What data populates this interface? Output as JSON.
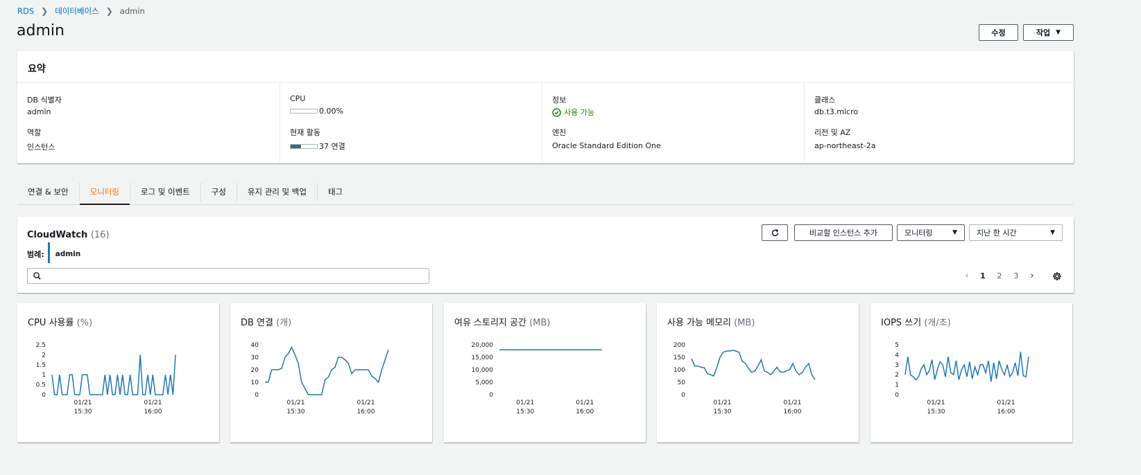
{
  "breadcrumb": {
    "root": "RDS",
    "middle": "데이터베이스",
    "current": "admin"
  },
  "page_title": "admin",
  "actions": {
    "modify": "수정",
    "actions_menu": "작업"
  },
  "summary": {
    "heading": "요약",
    "db_id_label": "DB 식별자",
    "db_id": "admin",
    "role_label": "역할",
    "role": "인스턴스",
    "cpu_label": "CPU",
    "cpu_value": "0.00%",
    "cpu_fraction": 0.0,
    "activity_label": "현재 활동",
    "activity_value": "37 연결",
    "activity_fraction": 0.4,
    "info_label": "정보",
    "info_value": "사용 가능",
    "engine_label": "엔진",
    "engine": "Oracle Standard Edition One",
    "class_label": "클래스",
    "class": "db.t3.micro",
    "region_label": "리전 및 AZ",
    "region": "ap-northeast-2a"
  },
  "tabs": [
    {
      "label": "연결 & 보안"
    },
    {
      "label": "모니터링"
    },
    {
      "label": "로그 및 이벤트"
    },
    {
      "label": "구성"
    },
    {
      "label": "유지 관리 및 백업"
    },
    {
      "label": "태그"
    }
  ],
  "cloudwatch": {
    "title": "CloudWatch",
    "count": "(16)",
    "legend_label": "범례:",
    "legend_item": "admin",
    "search_value": "",
    "compare_button": "비교할 인스턴스 추가",
    "monitoring_select": "모니터링",
    "time_select": "지난 한 시간",
    "pages": [
      "1",
      "2",
      "3"
    ],
    "current_page": "1"
  },
  "colors": {
    "line": "#1f77b4",
    "link": "#0073bb",
    "active_tab": "#ec7211",
    "available": "#1d8102"
  },
  "chart_data": [
    {
      "type": "line",
      "title": "CPU 사용률",
      "unit": "(%)",
      "yticks": [
        "2.5",
        "2",
        "1.5",
        "1",
        "0.5",
        "0"
      ],
      "ylim": [
        0,
        2.5
      ],
      "xticks": [
        [
          "01/21",
          "15:30"
        ],
        [
          "01/21",
          "16:00"
        ]
      ],
      "series": [
        {
          "values": [
            1,
            0,
            0,
            1,
            0,
            0,
            0,
            1,
            1,
            0,
            0,
            0,
            1,
            1,
            1,
            0,
            0,
            0,
            0,
            0,
            0,
            1,
            0,
            1,
            0,
            0,
            1,
            0,
            1,
            0,
            0,
            1,
            0,
            0,
            0,
            2,
            0,
            0,
            1,
            0,
            1,
            0,
            0,
            0,
            0,
            1,
            0,
            1,
            0,
            2
          ]
        }
      ]
    },
    {
      "type": "line",
      "title": "DB 연결",
      "unit": "(개)",
      "yticks": [
        "40",
        "30",
        "20",
        "10",
        "0"
      ],
      "ylim": [
        0,
        40
      ],
      "xticks": [
        [
          "01/21",
          "15:30"
        ],
        [
          "01/21",
          "16:00"
        ]
      ],
      "series": [
        {
          "values": [
            10,
            10,
            20,
            20,
            20,
            21,
            30,
            33,
            38,
            32,
            25,
            10,
            5,
            0,
            0,
            0,
            0,
            0,
            12,
            14,
            20,
            22,
            30,
            30,
            28,
            25,
            17,
            20,
            20,
            20,
            20,
            20,
            15,
            13,
            10,
            20,
            28,
            36
          ]
        }
      ]
    },
    {
      "type": "line",
      "title": "여유 스토리지 공간",
      "unit": "(MB)",
      "yticks": [
        "20,000",
        "15,000",
        "10,000",
        "5,000",
        "0"
      ],
      "ylim": [
        0,
        20000
      ],
      "xticks": [
        [
          "01/21",
          "15:30"
        ],
        [
          "01/21",
          "16:00"
        ]
      ],
      "series": [
        {
          "values": [
            18000,
            18000,
            18000,
            18000,
            18000,
            18000,
            18000,
            18000
          ]
        }
      ]
    },
    {
      "type": "line",
      "title": "사용 가능 메모리",
      "unit": "(MB)",
      "yticks": [
        "200",
        "150",
        "100",
        "50",
        "0"
      ],
      "ylim": [
        0,
        200
      ],
      "xticks": [
        [
          "01/21",
          "15:30"
        ],
        [
          "01/21",
          "16:00"
        ]
      ],
      "series": [
        {
          "values": [
            145,
            115,
            115,
            110,
            108,
            85,
            80,
            75,
            110,
            150,
            170,
            175,
            175,
            178,
            175,
            170,
            135,
            125,
            105,
            90,
            95,
            115,
            140,
            95,
            90,
            80,
            95,
            110,
            92,
            90,
            95,
            100,
            125,
            95,
            80,
            90,
            110,
            125,
            80,
            60
          ]
        }
      ]
    },
    {
      "type": "line",
      "title": "IOPS 쓰기",
      "unit": "(개/초)",
      "yticks": [
        "5",
        "4",
        "3",
        "2",
        "1",
        "0"
      ],
      "ylim": [
        0,
        5
      ],
      "xticks": [
        [
          "01/21",
          "15:30"
        ],
        [
          "01/21",
          "16:00"
        ]
      ],
      "series": [
        {
          "values": [
            2.0,
            3.8,
            2.0,
            1.8,
            1.5,
            1.8,
            2.6,
            3.0,
            2.0,
            2.4,
            3.5,
            1.5,
            2.5,
            3.3,
            3.0,
            1.8,
            3.8,
            2.2,
            2.0,
            3.4,
            1.5,
            2.5,
            3.0,
            1.8,
            3.3,
            1.6,
            2.8,
            2.0,
            3.0,
            3.0,
            2.2,
            3.4,
            1.3,
            3.2,
            1.6,
            3.4,
            2.5,
            2.0,
            3.0,
            1.8,
            2.2,
            3.2,
            1.9,
            4.3,
            1.9,
            1.8,
            3.8
          ]
        }
      ]
    }
  ]
}
